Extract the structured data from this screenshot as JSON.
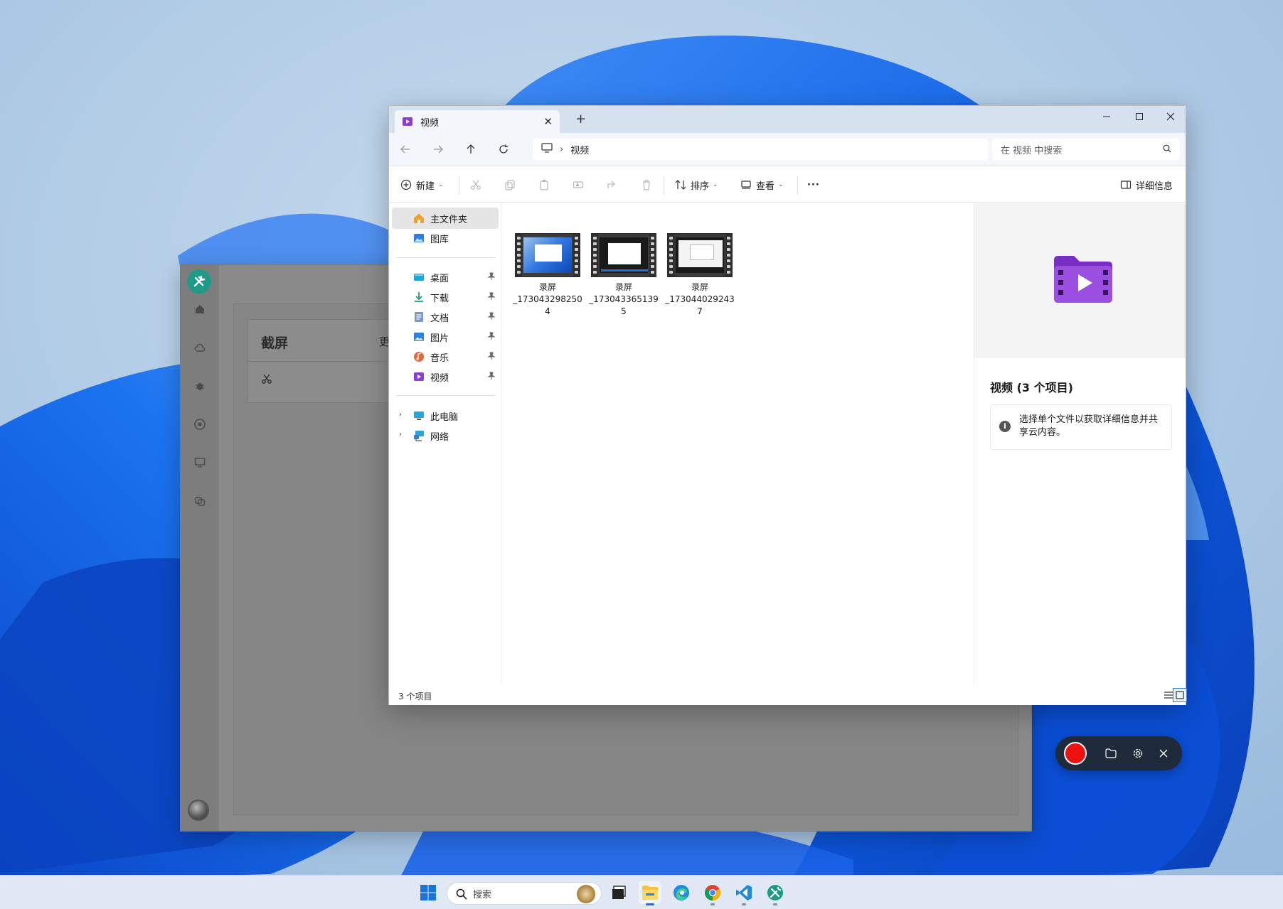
{
  "background_app": {
    "card_title": "截屏",
    "card_extra": "更"
  },
  "explorer": {
    "tab_title": "视频",
    "address": {
      "crumb": "视频"
    },
    "search_placeholder": "在 视频 中搜索",
    "commands": {
      "new": "新建",
      "sort": "排序",
      "view": "查看",
      "more": "···",
      "details": "详细信息"
    },
    "sidebar": {
      "top": [
        {
          "label": "主文件夹",
          "icon": "home-icon"
        },
        {
          "label": "图库",
          "icon": "gallery-icon"
        }
      ],
      "quick": [
        {
          "label": "桌面",
          "icon": "desktop-folder-icon"
        },
        {
          "label": "下载",
          "icon": "download-icon"
        },
        {
          "label": "文档",
          "icon": "document-icon"
        },
        {
          "label": "图片",
          "icon": "pictures-icon"
        },
        {
          "label": "音乐",
          "icon": "music-icon"
        },
        {
          "label": "视频",
          "icon": "video-icon"
        }
      ],
      "tree": [
        {
          "label": "此电脑",
          "icon": "this-pc-icon"
        },
        {
          "label": "网络",
          "icon": "network-icon"
        }
      ]
    },
    "files": [
      {
        "line1": "录屏",
        "line2": "_173043298250",
        "line3": "4"
      },
      {
        "line1": "录屏",
        "line2": "_173043365139",
        "line3": "5"
      },
      {
        "line1": "录屏",
        "line2": "_173044029243",
        "line3": "7"
      }
    ],
    "details_pane": {
      "title": "视频 (3 个项目)",
      "info": "选择单个文件以获取详细信息并共享云内容。"
    },
    "status": {
      "count": "3 个项目"
    }
  },
  "taskbar": {
    "search_placeholder": "搜索"
  },
  "colors": {
    "accent": "#1a73d9",
    "record": "#ee1111",
    "video_purple": "#8a3fd1",
    "tool_teal": "#1f9a86"
  }
}
